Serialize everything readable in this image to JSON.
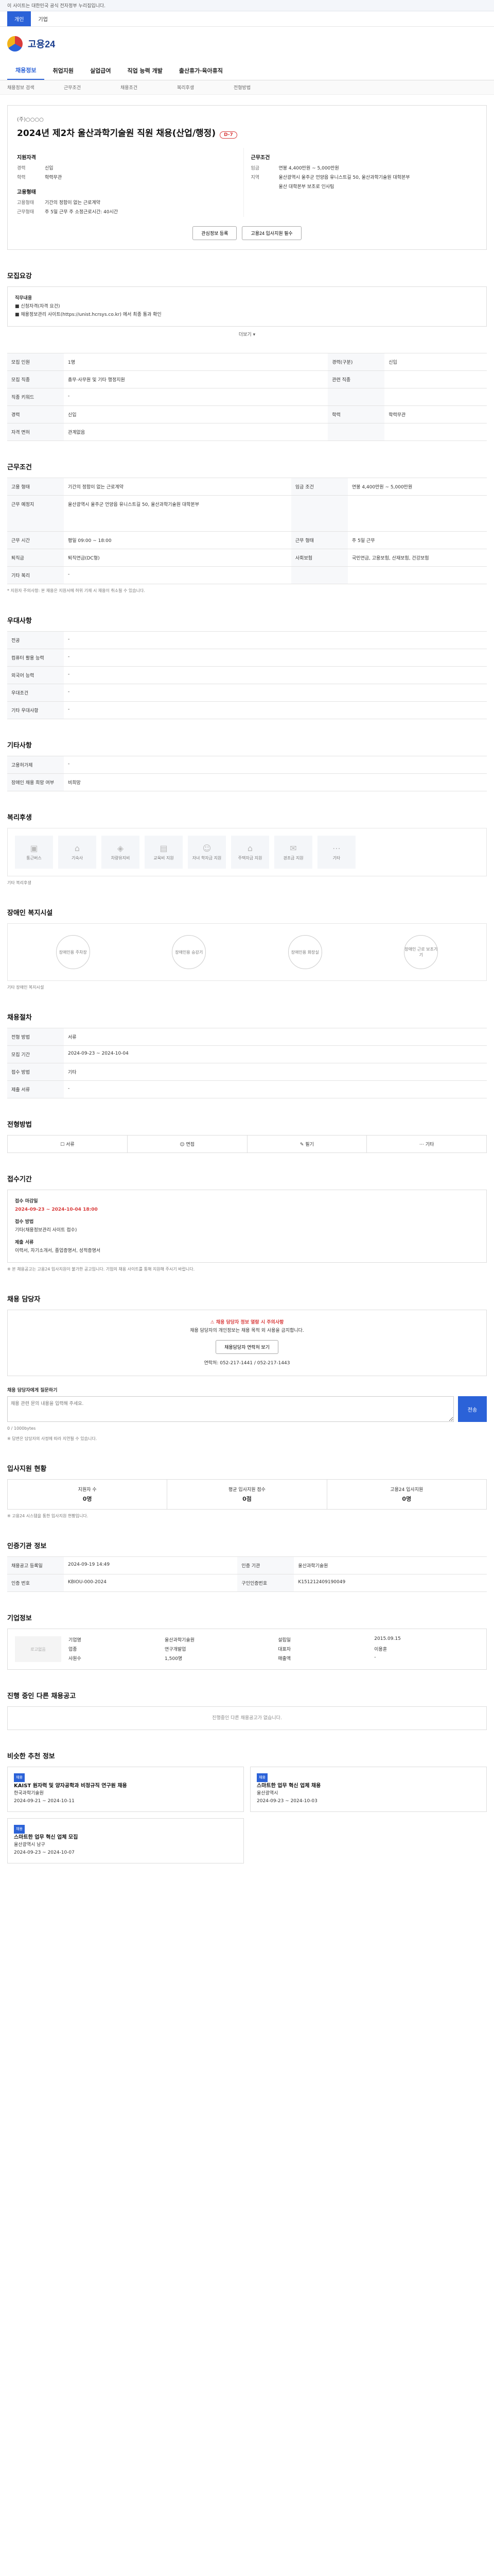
{
  "topbar": {
    "notice": "이 사이트는 대한민국 공식 전자정부 누리집입니다."
  },
  "gnb": {
    "tabs": [
      "개인",
      "기업"
    ]
  },
  "brand": {
    "name": "고용24"
  },
  "mainnav": [
    "채용정보",
    "취업지원",
    "실업급여",
    "직업 능력 개발",
    "출산휴가·육아휴직"
  ],
  "subnav": [
    "채용정보 검색",
    "근무조건",
    "채용조건",
    "복리후생",
    "전형방법"
  ],
  "job": {
    "company": "(주)○○○○",
    "title": "2024년 제2차 울산과학기술원 직원 채용(산업/행정)",
    "dday": "D-7",
    "left_title": "지원자격",
    "left_rows": [
      {
        "k": "경력",
        "v": "신입"
      },
      {
        "k": "학력",
        "v": "학력무관"
      }
    ],
    "right_title": "근무조건",
    "right_rows": [
      {
        "k": "임금",
        "v": "연봉 4,400만원 ~ 5,000만원"
      },
      {
        "k": "지역",
        "v": "울산광역시 울주군 언양읍 유니스트길 50, 울산과학기술원 대학본부"
      },
      {
        "k": "",
        "v": "울산 대학본부 보조로 인사팀"
      }
    ],
    "left2_title": "고용형태",
    "left2_rows": [
      {
        "k": "고용형태",
        "v": "기간의 정함이 없는 근로계약"
      },
      {
        "k": "근무형태",
        "v": "주 5일 근무 주 소정근로시간: 40시간"
      }
    ],
    "btn_save": "관심정보 등록",
    "btn_share": "고용24 입사지원 필수"
  },
  "recruit": {
    "title": "모집요강",
    "content_title": "직무내용",
    "lines": [
      "■ 신청자격(자격 요건)",
      "■ 채용정보관리 사이트(https://unist.hcrsys.co.kr) 에서 최종 통과 확인"
    ]
  },
  "toggle": "더보기",
  "job_table": [
    {
      "k": "모집 인원",
      "v": "1명",
      "k2": "경력(구분)",
      "v2": "신입"
    },
    {
      "k": "모집 직종",
      "v": "총무·사무원 및 기타 행정지원",
      "k2": "관련 직종",
      "v2": ""
    },
    {
      "k": "직종 키워드",
      "v": "-",
      "k2": "",
      "v2": ""
    },
    {
      "k": "경력",
      "v": "신입",
      "k2": "학력",
      "v2": "학력무관"
    },
    {
      "k": "자격 면허",
      "v": "관계없음",
      "k2": "",
      "v2": ""
    }
  ],
  "work_title": "근무조건",
  "work_table": [
    {
      "k": "고용 형태",
      "v": "기간의 정함이 없는 근로계약",
      "k2": "임금 조건",
      "v2": "연봉 4,400만원 ~ 5,000만원"
    },
    {
      "k": "근무 예정지",
      "v": "울산광역시 울주군 언양읍 유니스트길 50, 울산과학기술원 대학본부",
      "k2": "",
      "v2": ""
    },
    {
      "k": "근무 시간",
      "v": "평일 09:00 ~ 18:00",
      "k2": "근무 형태",
      "v2": "주 5일 근무"
    },
    {
      "k": "퇴직금",
      "v": "퇴직연금(DC형)",
      "k2": "사회보험",
      "v2": "국민연금, 고용보험, 산재보험, 건강보험"
    },
    {
      "k": "기타 복리",
      "v": "-",
      "k2": "",
      "v2": ""
    }
  ],
  "work_note": "* 지원자 주의사항: 본 채용은 지원서에 허위 기재 시 채용이 취소될 수 있습니다.",
  "welfare_title": "우대사항",
  "welfare_rows": [
    {
      "k": "전공",
      "v": "-"
    },
    {
      "k": "컴퓨터 활용 능력",
      "v": "-"
    },
    {
      "k": "외국어 능력",
      "v": "-"
    },
    {
      "k": "우대조건",
      "v": "-"
    },
    {
      "k": "기타 우대사항",
      "v": "-"
    }
  ],
  "other_title": "기타사항",
  "other_rows": [
    {
      "k": "고용허가제",
      "v": "-"
    },
    {
      "k": "장애인 채용 희망 여부",
      "v": "비희망"
    }
  ],
  "benefit_title": "복리후생",
  "benefits": [
    "통근버스",
    "기숙사",
    "차량유지비",
    "교육비 지원",
    "자녀 학자금 지원",
    "주택자금 지원",
    "경조금 지원",
    "기타"
  ],
  "benefit_note": "기타 복리후생",
  "disability_title": "장애인 복지시설",
  "disability_items": [
    "장애인용 주차장",
    "장애인용 승강기",
    "장애인용 화장실",
    "장애인 근로 보조기기"
  ],
  "disability_note": "기타 장애인 복지시설",
  "process_title": "채용절차",
  "process_rows": [
    {
      "k": "전형 방법",
      "v": "서류"
    },
    {
      "k": "모집 기간",
      "v": "2024-09-23 ~ 2024-10-04"
    },
    {
      "k": "접수 방법",
      "v": "기타"
    },
    {
      "k": "제출 서류",
      "v": "-"
    }
  ],
  "method_title": "전형방법",
  "methods": [
    "서류",
    "면접",
    "필기",
    "기타"
  ],
  "apply_title": "접수기간",
  "apply": {
    "label": "접수 마감일",
    "period": "2024-09-23 ~ 2024-10-04 18:00",
    "method_label": "접수 방법",
    "method": "기타(채용정보관리 사이트 접수)",
    "docs_label": "제출 서류",
    "docs": "이력서, 자기소개서, 졸업증명서, 성적증명서"
  },
  "apply_note": "※ 본 채용공고는 고용24 입사지원이 불가한 공고입니다. 기업의 채용 사이트를 통해 지원해 주시기 바랍니다.",
  "contact_title": "채용 담당자",
  "contact": {
    "warn": "채용 담당자 정보 열람 시 주의사항",
    "text": "채용 담당자의 개인정보는 채용 목적 외 사용을 금지합니다.",
    "btn": "채용담당자 연락처 보기",
    "phone": "연락처: 052-217-1441 / 052-217-1443"
  },
  "inquiry": {
    "label": "채용 담당자에게 질문하기",
    "placeholder": "채용 관련 문의 내용을 입력해 주세요.",
    "count": "0 / 1000bytes",
    "btn": "전송",
    "note": "※ 답변은 담당자의 사정에 따라 지연될 수 있습니다."
  },
  "status_title": "입사지원 현황",
  "stats": [
    {
      "label": "지원자 수",
      "v": "0명"
    },
    {
      "label": "평균 입사지원 점수",
      "v": "0점"
    },
    {
      "label": "고용24 입사지원",
      "v": "0명"
    }
  ],
  "status_note": "※ 고용24 시스템을 통한 입사지원 현황입니다.",
  "manage_title": "인증기관 정보",
  "manage_table": [
    {
      "k": "채용공고 등록일",
      "v": "2024-09-19 14:49",
      "k2": "인증 기관",
      "v2": "울산과학기술원"
    },
    {
      "k": "인증 번호",
      "v": "KBIOU-000-2024",
      "k2": "구인인증번호",
      "v2": "K151212409190049"
    }
  ],
  "company_title": "기업정보",
  "company": {
    "logo": "로고없음",
    "rows": [
      "기업명",
      "울산과학기술원",
      "설립일",
      "2015.09.15",
      "업종",
      "연구개발업",
      "대표자",
      "이용훈",
      "사원수",
      "1,500명",
      "매출액",
      "-"
    ]
  },
  "similar_title": "진행 중인 다른 채용공고",
  "similar_empty": "진행중인 다른 채용공고가 없습니다.",
  "recs_title": "비슷한 추천 정보",
  "recs": [
    {
      "tag": "채용",
      "title": "KAIST 원자력 및 양자공학과 비정규직 연구원 채용",
      "org": "한국과학기술원",
      "date": "2024-09-21 ~ 2024-10-11"
    },
    {
      "tag": "채용",
      "title": "스마트한 업무 혁신 업체 채용",
      "org": "울산광역시",
      "date": "2024-09-23 ~ 2024-10-03"
    },
    {
      "tag": "채용",
      "title": "스마트한 업무 혁신 업체 모집",
      "org": "울산광역시 남구",
      "date": "2024-09-23 ~ 2024-10-07"
    }
  ]
}
